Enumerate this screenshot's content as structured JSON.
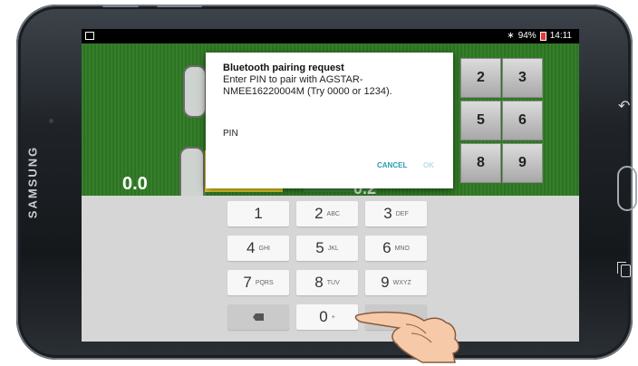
{
  "device": {
    "brand": "SAMSUNG",
    "frame_color": "#1f2328"
  },
  "statusbar": {
    "battery": "94%",
    "time": "14:11",
    "bluetooth_icon": "bluetooth-icon"
  },
  "app": {
    "left_value": "0.0",
    "center_value": "0.2",
    "numpad": [
      "2",
      "3",
      "5",
      "6",
      "8",
      "9"
    ],
    "background_color": "#2f7a24"
  },
  "dialog": {
    "title": "Bluetooth pairing request",
    "message": "Enter PIN to pair with AGSTAR-NMEE16220004M (Try 0000 or 1234).",
    "pin_label": "PIN",
    "cancel_label": "CANCEL",
    "ok_label": "OK",
    "accent_color": "#2a9bb0"
  },
  "keyboard": {
    "keys": [
      {
        "digit": "1",
        "letters": ""
      },
      {
        "digit": "2",
        "letters": "ABC"
      },
      {
        "digit": "3",
        "letters": "DEF"
      },
      {
        "digit": "4",
        "letters": "GHI"
      },
      {
        "digit": "5",
        "letters": "JKL"
      },
      {
        "digit": "6",
        "letters": "MNO"
      },
      {
        "digit": "7",
        "letters": "PQRS"
      },
      {
        "digit": "8",
        "letters": "TUV"
      },
      {
        "digit": "9",
        "letters": "WXYZ"
      },
      {
        "digit": "0",
        "letters": "+"
      }
    ],
    "backspace_icon": "backspace-icon"
  }
}
